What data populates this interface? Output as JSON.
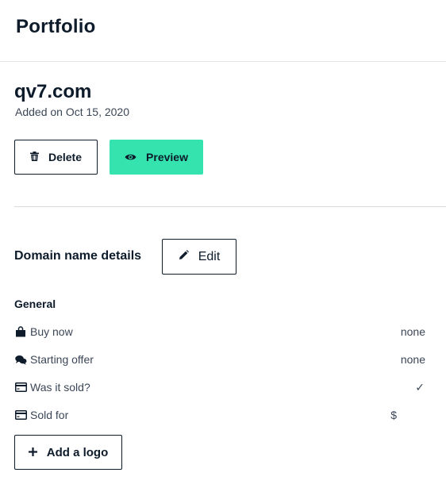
{
  "header": {
    "title": "Portfolio"
  },
  "domain": {
    "name": "qv7.com",
    "added_on": "Added on Oct 15, 2020"
  },
  "actions": {
    "delete_label": "Delete",
    "preview_label": "Preview"
  },
  "details": {
    "section_title": "Domain name details",
    "edit_label": "Edit",
    "general_title": "General",
    "rows": [
      {
        "label": "Buy now",
        "value": "none",
        "icon": "shopping-bag-icon"
      },
      {
        "label": "Starting offer",
        "value": "none",
        "icon": "chat-bubbles-icon"
      },
      {
        "label": "Was it sold?",
        "value": "✓",
        "icon": "credit-card-icon"
      },
      {
        "label": "Sold for",
        "value": "$",
        "icon": "credit-card-icon"
      }
    ]
  },
  "add_logo_label": "Add a logo",
  "colors": {
    "accent": "#34e3ae",
    "text": "#0d1b2a",
    "muted": "#3b4656"
  }
}
